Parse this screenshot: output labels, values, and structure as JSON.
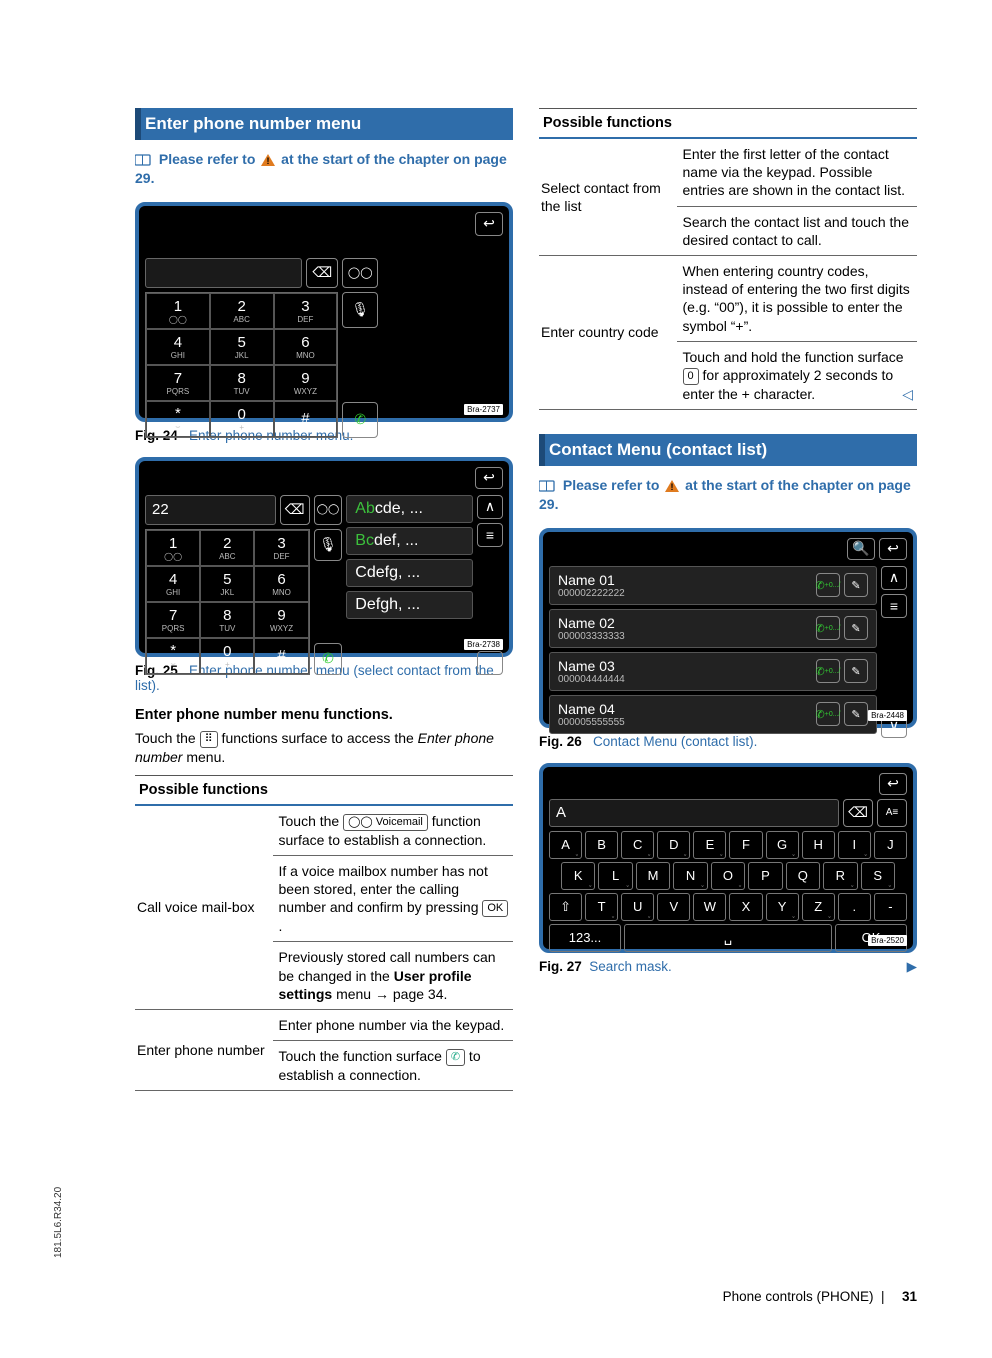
{
  "left": {
    "heading": "Enter phone number menu",
    "refer": "Please refer to ",
    "refer2": " at the start of the chapter on page 29.",
    "fig24": {
      "code": "Bra-2737",
      "caption_label": "Fig. 24",
      "caption_text": "Enter phone number menu.",
      "keys": [
        {
          "d": "1",
          "s": "◯◯"
        },
        {
          "d": "2",
          "s": "ABC"
        },
        {
          "d": "3",
          "s": "DEF"
        },
        {
          "d": "4",
          "s": "GHI"
        },
        {
          "d": "5",
          "s": "JKL"
        },
        {
          "d": "6",
          "s": "MNO"
        },
        {
          "d": "7",
          "s": "PQRS"
        },
        {
          "d": "8",
          "s": "TUV"
        },
        {
          "d": "9",
          "s": "WXYZ"
        },
        {
          "d": "*",
          "s": "⌣"
        },
        {
          "d": "0",
          "s": "+"
        },
        {
          "d": "#",
          "s": ""
        }
      ]
    },
    "fig25": {
      "code": "Bra-2738",
      "caption_label": "Fig. 25",
      "caption_text": "Enter phone number menu (select contact from the list).",
      "input": "22",
      "suggest": [
        {
          "hi": "Ab",
          "rest": "cde, ..."
        },
        {
          "hi": "Bc",
          "rest": "def, ..."
        },
        {
          "hi": "",
          "rest": "Cdefg, ..."
        },
        {
          "hi": "",
          "rest": "Defgh, ..."
        }
      ]
    },
    "subhead": "Enter phone number menu functions.",
    "body1a": "Touch the ",
    "body1b": " functions surface to access the ",
    "body1c": "Enter phone number",
    "body1d": " menu.",
    "dial_icon": "⠿",
    "tbl_header": "Possible functions",
    "rows": [
      {
        "label": "Call voice mail-box",
        "segs": [
          {
            "pre": "Touch the ",
            "key": "◯◯ Voicemail",
            "post": " function surface to establish a connection."
          },
          {
            "text": "If a voice mailbox number has not been stored, enter the calling number and confirm by pressing ",
            "key": "OK",
            "post": "."
          },
          {
            "text": "Previously stored call numbers can be changed in the ",
            "bold": "User profile settings",
            "post": " menu → page 34."
          }
        ]
      },
      {
        "label": "Enter phone number",
        "segs": [
          {
            "text": "Enter phone number via the keypad."
          },
          {
            "text": "Touch the function surface ",
            "icon": "✆",
            "post": " to establish a connection."
          }
        ]
      }
    ]
  },
  "right": {
    "tbl_header": "Possible functions",
    "rows": [
      {
        "label": "Select contact from the list",
        "segs": [
          {
            "text": "Enter the first letter of the contact name via the keypad. Possible entries are shown in the contact list."
          },
          {
            "text": "Search the contact list and touch the desired contact to call."
          }
        ]
      },
      {
        "label": "Enter country code",
        "segs": [
          {
            "text": "When entering country codes, instead of entering the two first digits (e.g. “00”), it is possible to enter the symbol “+”."
          },
          {
            "text": "Touch and hold the function surface ",
            "key": "0",
            "post": " for approximately 2 seconds to enter the + character.",
            "endmark": true
          }
        ]
      }
    ],
    "heading2": "Contact Menu (contact list)",
    "refer": "Please refer to ",
    "refer2": " at the start of the chapter on page 29.",
    "fig26": {
      "code": "Bra-2448",
      "caption_label": "Fig. 26",
      "caption_text": "Contact Menu (contact list).",
      "contacts": [
        {
          "name": "Name 01",
          "num": "000002222222",
          "tag": "+0.../"
        },
        {
          "name": "Name 02",
          "num": "000003333333",
          "tag": "+0.../"
        },
        {
          "name": "Name 03",
          "num": "000004444444",
          "tag": "+0.../"
        },
        {
          "name": "Name 04",
          "num": "000005555555",
          "tag": "+0.../"
        }
      ]
    },
    "fig27": {
      "code": "Bra-2520",
      "caption_label": "Fig. 27",
      "caption_text": "Search mask.",
      "input": "A",
      "row1": [
        {
          "k": "A",
          "t": 1
        },
        {
          "k": "B"
        },
        {
          "k": "C",
          "t": 1
        },
        {
          "k": "D",
          "t": 1
        },
        {
          "k": "E",
          "t": 1
        },
        {
          "k": "F"
        },
        {
          "k": "G",
          "t": 1
        },
        {
          "k": "H"
        },
        {
          "k": "I",
          "t": 1
        },
        {
          "k": "J"
        }
      ],
      "row2": [
        {
          "k": "K",
          "t": 1
        },
        {
          "k": "L",
          "t": 1
        },
        {
          "k": "M"
        },
        {
          "k": "N",
          "t": 1
        },
        {
          "k": "O",
          "t": 1
        },
        {
          "k": "P"
        },
        {
          "k": "Q"
        },
        {
          "k": "R",
          "t": 1
        },
        {
          "k": "S",
          "t": 1
        }
      ],
      "row3": [
        {
          "k": "⇧"
        },
        {
          "k": "T",
          "t": 1
        },
        {
          "k": "U",
          "t": 1
        },
        {
          "k": "V"
        },
        {
          "k": "W"
        },
        {
          "k": "X"
        },
        {
          "k": "Y",
          "t": 1
        },
        {
          "k": "Z",
          "t": 1
        },
        {
          "k": "."
        },
        {
          "k": "-"
        }
      ],
      "bottom": {
        "mode": "123...",
        "space": "␣",
        "ok": "OK"
      }
    }
  },
  "footer": {
    "section": "Phone controls (PHONE)",
    "page": "31"
  },
  "sidecode": "181.5L6.R34.20"
}
